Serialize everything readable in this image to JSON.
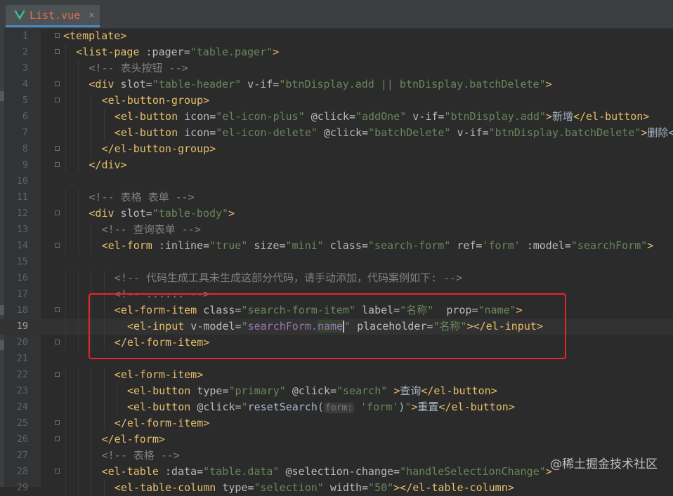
{
  "tab": {
    "filename": "List.vue",
    "close": "×"
  },
  "watermark": "@稀土掘金技术社区",
  "lines": [
    {
      "n": "1",
      "indent": 0,
      "spans": [
        [
          "tg",
          "<template>"
        ]
      ]
    },
    {
      "n": "2",
      "indent": 1,
      "spans": [
        [
          "tg",
          "<list-page "
        ],
        [
          "at",
          ":pager="
        ],
        [
          "st",
          "\"table.pager\""
        ],
        [
          "tg",
          ">"
        ]
      ]
    },
    {
      "n": "3",
      "indent": 2,
      "spans": [
        [
          "cm",
          "<!-- 表头按钮 -->"
        ]
      ]
    },
    {
      "n": "4",
      "indent": 2,
      "spans": [
        [
          "tg",
          "<div "
        ],
        [
          "at",
          "slot="
        ],
        [
          "st",
          "\"table-header\" "
        ],
        [
          "at",
          "v-if="
        ],
        [
          "st",
          "\"btnDisplay.add || btnDisplay.batchDelete\""
        ],
        [
          "tg",
          ">"
        ]
      ]
    },
    {
      "n": "5",
      "indent": 3,
      "spans": [
        [
          "tg",
          "<el-button-group>"
        ]
      ]
    },
    {
      "n": "6",
      "indent": 4,
      "spans": [
        [
          "tg",
          "<el-button "
        ],
        [
          "at",
          "icon="
        ],
        [
          "st",
          "\"el-icon-plus\" "
        ],
        [
          "at",
          "@click="
        ],
        [
          "st",
          "\"addOne\" "
        ],
        [
          "at",
          "v-if="
        ],
        [
          "st",
          "\"btnDisplay.add\""
        ],
        [
          "tg",
          ">"
        ],
        [
          "tx",
          "新增"
        ],
        [
          "tg",
          "</el-button>"
        ]
      ]
    },
    {
      "n": "7",
      "indent": 4,
      "spans": [
        [
          "tg",
          "<el-button "
        ],
        [
          "at",
          "icon="
        ],
        [
          "st",
          "\"el-icon-delete\" "
        ],
        [
          "at",
          "@click="
        ],
        [
          "st",
          "\"batchDelete\" "
        ],
        [
          "at",
          "v-if="
        ],
        [
          "st",
          "\"btnDisplay.batchDelete\""
        ],
        [
          "tg",
          ">"
        ],
        [
          "tx",
          "删除<"
        ]
      ]
    },
    {
      "n": "8",
      "indent": 3,
      "spans": [
        [
          "tg",
          "</el-button-group>"
        ]
      ]
    },
    {
      "n": "9",
      "indent": 2,
      "spans": [
        [
          "tg",
          "</div>"
        ]
      ]
    },
    {
      "n": "10",
      "indent": 0,
      "spans": []
    },
    {
      "n": "11",
      "indent": 2,
      "spans": [
        [
          "cm",
          "<!-- 表格 表单 -->"
        ]
      ]
    },
    {
      "n": "12",
      "indent": 2,
      "spans": [
        [
          "tg",
          "<div "
        ],
        [
          "at",
          "slot="
        ],
        [
          "st",
          "\"table-body\""
        ],
        [
          "tg",
          ">"
        ]
      ]
    },
    {
      "n": "13",
      "indent": 3,
      "spans": [
        [
          "cm",
          "<!-- 查询表单 -->"
        ]
      ]
    },
    {
      "n": "14",
      "indent": 3,
      "spans": [
        [
          "tg",
          "<el-form "
        ],
        [
          "at",
          ":inline="
        ],
        [
          "st",
          "\"true\" "
        ],
        [
          "at",
          "size="
        ],
        [
          "st",
          "\"mini\" "
        ],
        [
          "at",
          "class="
        ],
        [
          "st",
          "\"search-form\" "
        ],
        [
          "at",
          "ref="
        ],
        [
          "st",
          "'form' "
        ],
        [
          "at",
          ":model="
        ],
        [
          "st",
          "\"searchForm\""
        ],
        [
          "tg",
          ">"
        ]
      ]
    },
    {
      "n": "15",
      "indent": 0,
      "spans": []
    },
    {
      "n": "16",
      "indent": 4,
      "spans": [
        [
          "cm",
          "<!-- 代码生成工具未生成这部分代码，请手动添加，代码案例如下: -->"
        ]
      ]
    },
    {
      "n": "17",
      "indent": 4,
      "spans": [
        [
          "cm",
          "<!-- ...... -->"
        ]
      ]
    },
    {
      "n": "18",
      "indent": 4,
      "spans": [
        [
          "tg",
          "<el-form-item "
        ],
        [
          "at",
          "class="
        ],
        [
          "st",
          "\"search-form-item\" "
        ],
        [
          "at",
          "label="
        ],
        [
          "st",
          "\"名称\"  "
        ],
        [
          "at",
          "prop="
        ],
        [
          "st",
          "\"name\""
        ],
        [
          "tg",
          ">"
        ]
      ]
    },
    {
      "n": "19",
      "indent": 5,
      "active": true,
      "spans": [
        [
          "tg",
          "<el-input "
        ],
        [
          "at",
          "v-model="
        ],
        [
          "st",
          "\""
        ],
        [
          "js",
          "searchForm."
        ],
        [
          "cw",
          "name"
        ],
        [
          "st",
          "\" "
        ],
        [
          "at",
          "placeholder="
        ],
        [
          "st",
          "\"名称\""
        ],
        [
          "tg",
          "></el-input>"
        ]
      ]
    },
    {
      "n": "20",
      "indent": 4,
      "spans": [
        [
          "tg",
          "</el-form-item>"
        ]
      ]
    },
    {
      "n": "21",
      "indent": 0,
      "spans": []
    },
    {
      "n": "22",
      "indent": 4,
      "spans": [
        [
          "tg",
          "<el-form-item>"
        ]
      ]
    },
    {
      "n": "23",
      "indent": 5,
      "spans": [
        [
          "tg",
          "<el-button "
        ],
        [
          "at",
          "type="
        ],
        [
          "st",
          "\"primary\" "
        ],
        [
          "at",
          "@click="
        ],
        [
          "st",
          "\"search\" "
        ],
        [
          "tg",
          ">"
        ],
        [
          "tx",
          "查询"
        ],
        [
          "tg",
          "</el-button>"
        ]
      ]
    },
    {
      "n": "24",
      "indent": 5,
      "spans": [
        [
          "tg",
          "<el-button "
        ],
        [
          "at",
          "@click="
        ],
        [
          "st",
          "\""
        ],
        [
          "tx",
          "resetSearch("
        ],
        [
          "hi",
          "form:"
        ],
        [
          "st",
          " 'form'"
        ],
        [
          "tx",
          ")"
        ],
        [
          "st",
          "\""
        ],
        [
          "tg",
          ">"
        ],
        [
          "tx",
          "重置"
        ],
        [
          "tg",
          "</el-button>"
        ]
      ]
    },
    {
      "n": "25",
      "indent": 4,
      "spans": [
        [
          "tg",
          "</el-form-item>"
        ]
      ]
    },
    {
      "n": "26",
      "indent": 3,
      "spans": [
        [
          "tg",
          "</el-form>"
        ]
      ]
    },
    {
      "n": "27",
      "indent": 3,
      "spans": [
        [
          "cm",
          "<!-- 表格 -->"
        ]
      ]
    },
    {
      "n": "28",
      "indent": 3,
      "spans": [
        [
          "tg",
          "<el-table "
        ],
        [
          "at",
          ":data="
        ],
        [
          "st",
          "\"table.data\" "
        ],
        [
          "at",
          "@selection-change="
        ],
        [
          "st",
          "\"handleSelectionChange\""
        ],
        [
          "tg",
          ">"
        ]
      ]
    },
    {
      "n": "29",
      "indent": 4,
      "spans": [
        [
          "tg",
          "<el-table-column "
        ],
        [
          "at",
          "type="
        ],
        [
          "st",
          "\"selection\" "
        ],
        [
          "at",
          "width="
        ],
        [
          "st",
          "\"50\""
        ],
        [
          "tg",
          "></el-table-column>"
        ]
      ]
    }
  ]
}
